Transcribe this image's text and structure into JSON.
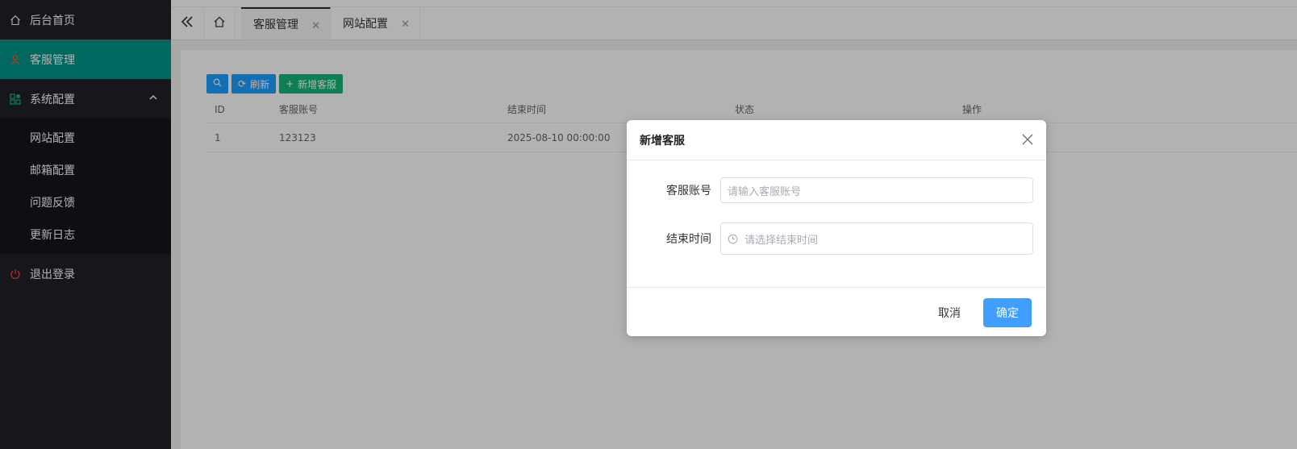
{
  "sidebar": {
    "items": [
      {
        "label": "后台首页",
        "icon": "home-icon"
      },
      {
        "label": "客服管理",
        "icon": "user-icon"
      },
      {
        "label": "系统配置",
        "icon": "apps-icon"
      },
      {
        "label": "退出登录",
        "icon": "power-icon"
      }
    ],
    "submenu": [
      {
        "label": "网站配置"
      },
      {
        "label": "邮箱配置"
      },
      {
        "label": "问题反馈"
      },
      {
        "label": "更新日志"
      }
    ]
  },
  "tabs": [
    {
      "label": "客服管理"
    },
    {
      "label": "网站配置"
    }
  ],
  "toolbar": {
    "refresh_label": "刷新",
    "add_label": "新增客服"
  },
  "table": {
    "headers": [
      "ID",
      "客服账号",
      "结束时间",
      "状态",
      "操作"
    ],
    "rows": [
      [
        "1",
        "123123",
        "2025-08-10 00:00:00",
        "",
        ""
      ]
    ]
  },
  "dialog": {
    "title": "新增客服",
    "account_label": "客服账号",
    "account_placeholder": "请输入客服账号",
    "end_time_label": "结束时间",
    "end_time_placeholder": "请选择结束时间",
    "cancel_label": "取消",
    "ok_label": "确定"
  },
  "colors": {
    "sidebar_bg": "#20222a",
    "active_bg": "#009688",
    "primary_button": "#409eff",
    "tool_blue": "#1e9fff",
    "tool_green": "#16b777",
    "logout_icon": "#ff3d3d",
    "user_icon": "#ff5722"
  }
}
